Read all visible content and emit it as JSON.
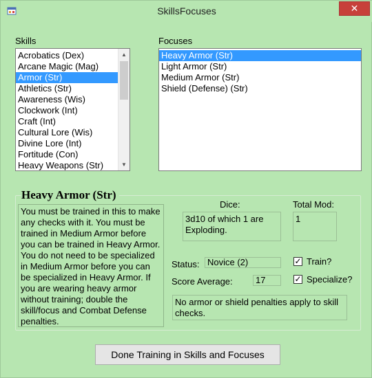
{
  "window": {
    "title": "SkillsFocuses",
    "close_label": "✕"
  },
  "skills": {
    "label": "Skills",
    "items": [
      "Acrobatics (Dex)",
      "Arcane Magic (Mag)",
      "Armor (Str)",
      "Athletics (Str)",
      "Awareness (Wis)",
      "Clockwork (Int)",
      "Craft (Int)",
      "Cultural Lore (Wis)",
      "Divine Lore (Int)",
      "Fortitude (Con)",
      "Heavy Weapons (Str)"
    ],
    "selected_index": 2
  },
  "focuses": {
    "label": "Focuses",
    "items": [
      "Heavy Armor (Str)",
      "Light Armor (Str)",
      "Medium Armor (Str)",
      "Shield (Defense) (Str)"
    ],
    "selected_index": 0
  },
  "detail": {
    "title": "Heavy Armor (Str)",
    "description": "You must be trained in this to make any checks with it. You must be trained in Medium Armor before you can be trained in Heavy Armor. You do not need to be specialized in Medium Armor before you can be specialized in Heavy Armor. If you are wearing heavy armor without training; double the skill/focus and Combat Defense penalties.",
    "dice_label": "Dice:",
    "dice_value": "3d10 of which 1 are Exploding.",
    "total_mod_label": "Total Mod:",
    "total_mod_value": "1",
    "status_label": "Status:",
    "status_value": "Novice (2)",
    "score_avg_label": "Score Average:",
    "score_avg_value": "17",
    "train_label": "Train?",
    "train_checked": true,
    "specialize_label": "Specialize?",
    "specialize_checked": true,
    "note": "No armor or shield penalties apply to skill checks."
  },
  "done_button": "Done Training in Skills and Focuses",
  "icons": {
    "window": "app-window-icon",
    "check": "checkmark-icon"
  }
}
